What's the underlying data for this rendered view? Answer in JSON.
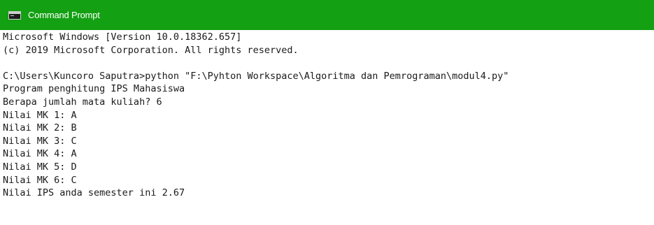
{
  "window": {
    "title": "Command Prompt"
  },
  "console": {
    "lines": [
      "Microsoft Windows [Version 10.0.18362.657]",
      "(c) 2019 Microsoft Corporation. All rights reserved.",
      "",
      "C:\\Users\\Kuncoro Saputra>python \"F:\\Pyhton Workspace\\Algoritma dan Pemrograman\\modul4.py\"",
      "Program penghitung IPS Mahasiswa",
      "Berapa jumlah mata kuliah? 6",
      "Nilai MK 1: A",
      "Nilai MK 2: B",
      "Nilai MK 3: C",
      "Nilai MK 4: A",
      "Nilai MK 5: D",
      "Nilai MK 6: C",
      "Nilai IPS anda semester ini 2.67"
    ]
  },
  "colors": {
    "titlebar": "#13a013",
    "console_bg": "#ffffff",
    "console_text": "#1a1a1a"
  },
  "icons": {
    "app": "command-prompt-icon"
  }
}
